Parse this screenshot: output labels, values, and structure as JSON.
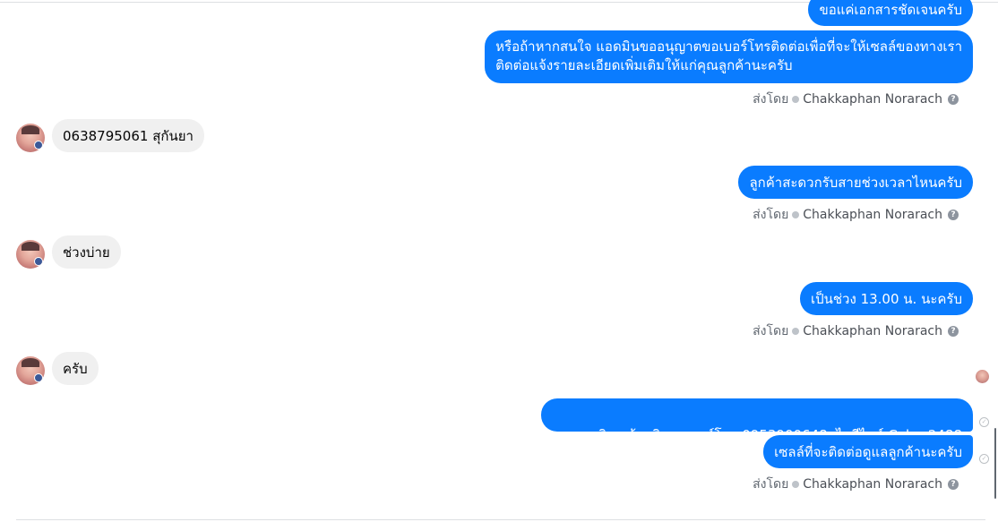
{
  "messages": {
    "m1": "ขอแค่เอกสารชัดเจนครับ",
    "m2_line1": "หรือถ้าหากสนใจ แอดมินขออนุญาตขอเบอร์โทรติดต่อเพื่อที่จะให้เซลล์ของทางเรา",
    "m2_line2": "ติดต่อแจ้งรายละเอียดเพิ่มเติมให้แก่คุณลูกค้านะครับ",
    "m3": "0638795061 สุกันยา",
    "m4": "ลูกค้าสะดวกรับสายช่วงเวลาไหนครับ",
    "m5": "ช่วงบ่าย",
    "m6": "เป็นช่วง 13.00 น. นะครับ",
    "m7": "ครับ",
    "m8": "คุณสุธิดา น้อยธิ      เบอร์โทร 0953900648  ไอดีไลน์ Cake_2488",
    "m9": "เซลล์ที่จะติดต่อดูแลลูกค้านะครับ"
  },
  "sent_by": {
    "prefix": "ส่งโดย",
    "name": "Chakkaphan Norarach",
    "help": "?"
  },
  "colors": {
    "outgoing_bubble": "#0a7cff",
    "incoming_bubble": "#f0f0f0"
  }
}
